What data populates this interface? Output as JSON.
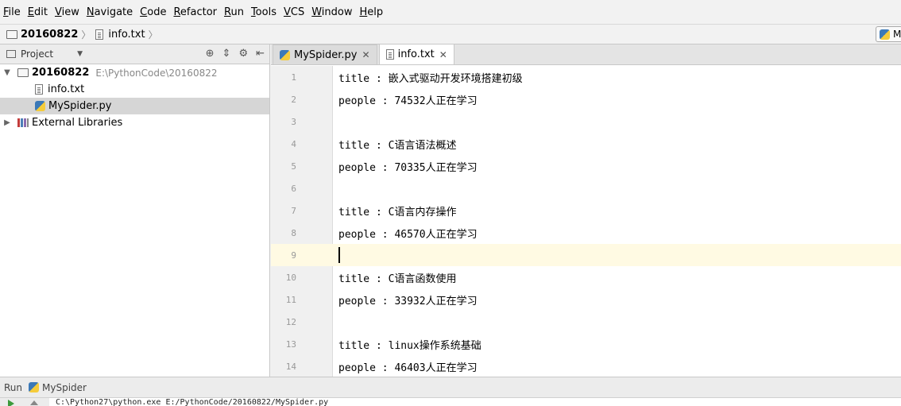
{
  "menu": [
    {
      "key": "F",
      "rest": "ile"
    },
    {
      "key": "E",
      "rest": "dit"
    },
    {
      "key": "V",
      "rest": "iew"
    },
    {
      "key": "N",
      "rest": "avigate"
    },
    {
      "key": "C",
      "rest": "ode"
    },
    {
      "key": "R",
      "rest": "efactor"
    },
    {
      "key": "R",
      "rest": "un"
    },
    {
      "key": "T",
      "rest": "ools"
    },
    {
      "key": "V",
      "rest": "CS"
    },
    {
      "key": "W",
      "rest": "indow"
    },
    {
      "key": "H",
      "rest": "elp"
    }
  ],
  "breadcrumb": {
    "project": "20160822",
    "file": "info.txt"
  },
  "run_config_label": "M",
  "project_panel": {
    "title": "Project",
    "root_name": "20160822",
    "root_path": "E:\\PythonCode\\20160822",
    "files": [
      "info.txt",
      "MySpider.py"
    ],
    "external_libraries": "External Libraries"
  },
  "tabs": [
    {
      "label": "MySpider.py",
      "active": false
    },
    {
      "label": "info.txt",
      "active": true
    }
  ],
  "editor": {
    "current_line": 9,
    "lines": [
      {
        "no": "1",
        "text": "title : 嵌入式驱动开发环境搭建初级"
      },
      {
        "no": "2",
        "text": "people : 74532人正在学习"
      },
      {
        "no": "3",
        "text": ""
      },
      {
        "no": "4",
        "text": "title : C语言语法概述"
      },
      {
        "no": "5",
        "text": "people : 70335人正在学习"
      },
      {
        "no": "6",
        "text": ""
      },
      {
        "no": "7",
        "text": "title : C语言内存操作"
      },
      {
        "no": "8",
        "text": "people : 46570人正在学习"
      },
      {
        "no": "9",
        "text": ""
      },
      {
        "no": "10",
        "text": "title : C语言函数使用"
      },
      {
        "no": "11",
        "text": "people : 33932人正在学习"
      },
      {
        "no": "12",
        "text": ""
      },
      {
        "no": "13",
        "text": "title : linux操作系统基础"
      },
      {
        "no": "14",
        "text": "people : 46403人正在学习"
      }
    ]
  },
  "run_panel": {
    "label": "Run",
    "config": "MySpider",
    "console_line": "C:\\Python27\\python.exe E:/PythonCode/20160822/MySpider.py"
  }
}
